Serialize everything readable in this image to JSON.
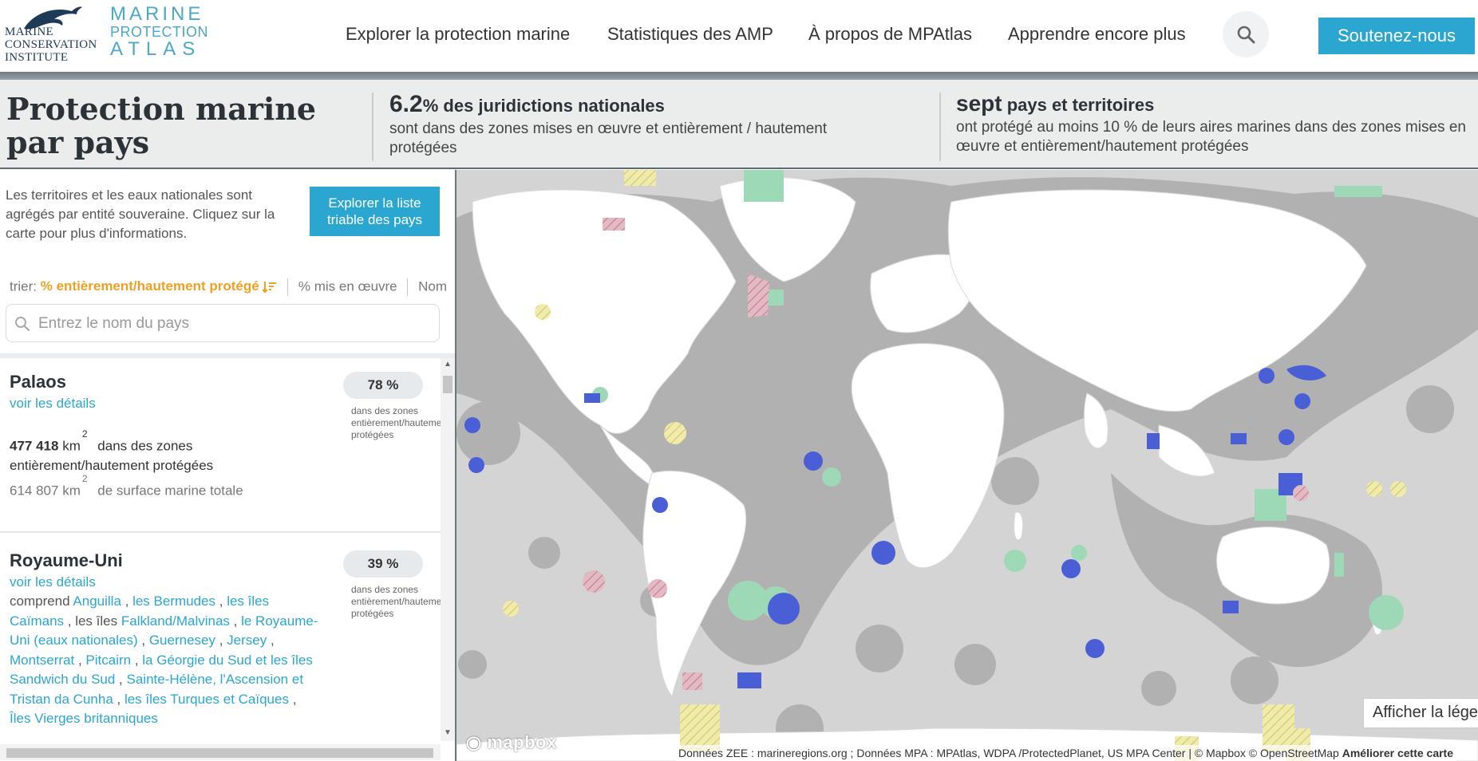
{
  "brand": {
    "mci_lines": [
      "MARINE",
      "CONSERVATION",
      "INSTITUTE"
    ],
    "mpa_lines": [
      "MARINE",
      "PROTECTION",
      "ATLAS"
    ]
  },
  "nav": {
    "items": [
      "Explorer la protection marine",
      "Statistiques des AMP",
      "À propos de MPAtlas",
      "Apprendre encore plus"
    ],
    "support_label": "Soutenez-nous"
  },
  "band": {
    "title": "Protection marine par pays",
    "stat1": {
      "big": "6.2",
      "head": "% des juridictions nationales",
      "sub": "sont dans des zones mises en œuvre et entièrement / hautement protégées"
    },
    "stat2": {
      "big": "sept",
      "head": " pays et territoires",
      "sub": "ont protégé au moins 10 % de leurs aires marines dans des zones mises en œuvre et entièrement/hautement protégées"
    }
  },
  "panel": {
    "intro": "Les territoires et les eaux nationales sont agrégés par entité souveraine. Cliquez sur la carte pour plus d'informations.",
    "explore_button": "Explorer la liste triable des pays",
    "sort": {
      "label": "trier:",
      "active": "% entièrement/hautement protégé",
      "mid": "% mis en œuvre",
      "last": "Nom"
    },
    "search_placeholder": "Entrez le nom du pays"
  },
  "countries": [
    {
      "name": "Palaos",
      "details": "voir les détails",
      "pct": "78 %",
      "pct_sub": "dans des zones entièrement/hautement protégées",
      "protected_area": "477 418",
      "unit": "km",
      "sup": "2",
      "protected_suffix": "dans des zones entièrement/hautement protégées",
      "total_area": "614 807",
      "total_suffix": "de surface marine totale"
    },
    {
      "name": "Royaume-Uni",
      "details": "voir les détails",
      "pct": "39 %",
      "pct_sub": "dans des zones entièrement/hautement protégées",
      "includes_label": "comprend",
      "territories": [
        "Anguilla",
        "les Bermudes",
        "les îles Caïmans",
        "les îles",
        "Falkland/Malvinas",
        "le Royaume-Uni (eaux nationales)",
        "Guernesey",
        "Jersey",
        "Montserrat",
        "Pitcairn",
        "la Géorgie du Sud et les îles Sandwich du Sud",
        "Sainte-Hélène, l'Ascension et Tristan da Cunha",
        "les îles Turques et Caïques",
        "Îles Vierges britanniques"
      ]
    }
  ],
  "map": {
    "legend_button": "Afficher la légende",
    "mapbox_label": "mapbox",
    "attribution": "Données ZEE : marineregions.org ; Données MPA : MPAtlas, WDPA /ProtectedPlanet, US MPA Center | © Mapbox © OpenStreetMap",
    "improve": "Améliorer cette carte",
    "colors": {
      "land": "#ffffff",
      "ocean": "#d2d2d2",
      "eez": "#a9a9a9",
      "fully": "#4a5fd6",
      "implemented": "#9dd9b6",
      "proposed": "#f0eba8",
      "hatched": "#d79aa8"
    }
  }
}
